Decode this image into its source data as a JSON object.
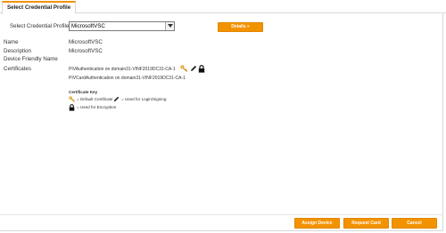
{
  "tabs": [
    {
      "label": "Select Credential Profile"
    }
  ],
  "profile_select": {
    "label": "Select Credential Profile:",
    "selected": "MicrosoftVSC"
  },
  "details_button": "Details »",
  "fields": [
    {
      "label": "Name",
      "value": "MicrosoftVSC"
    },
    {
      "label": "Description",
      "value": "MicrosoftVSC"
    },
    {
      "label": "Device Friendly Name",
      "value": ""
    }
  ],
  "certificates": {
    "label": "Certificates",
    "items": [
      "PIVAuthentication on domain31-VINF2019DC31-CA-1",
      "PIVCardAuthentication on domain31-VINF2019DC31-CA-1"
    ],
    "icons": [
      "key-icon",
      "pen-icon",
      "lock-icon"
    ]
  },
  "certificate_key": {
    "title": "Certificate Key",
    "entries": [
      {
        "icon": "key-icon",
        "text": "= Default Certificate"
      },
      {
        "icon": "pen-icon",
        "text": "= Used for Login/Signing"
      },
      {
        "icon": "lock-icon",
        "text": "= Used for Encryption"
      }
    ]
  },
  "footer": {
    "assign_label": "Assign Device",
    "request_label": "Request Card",
    "cancel_label": "Cancel"
  },
  "colors": {
    "accent": "#f39200",
    "border": "#d8d8d8"
  }
}
